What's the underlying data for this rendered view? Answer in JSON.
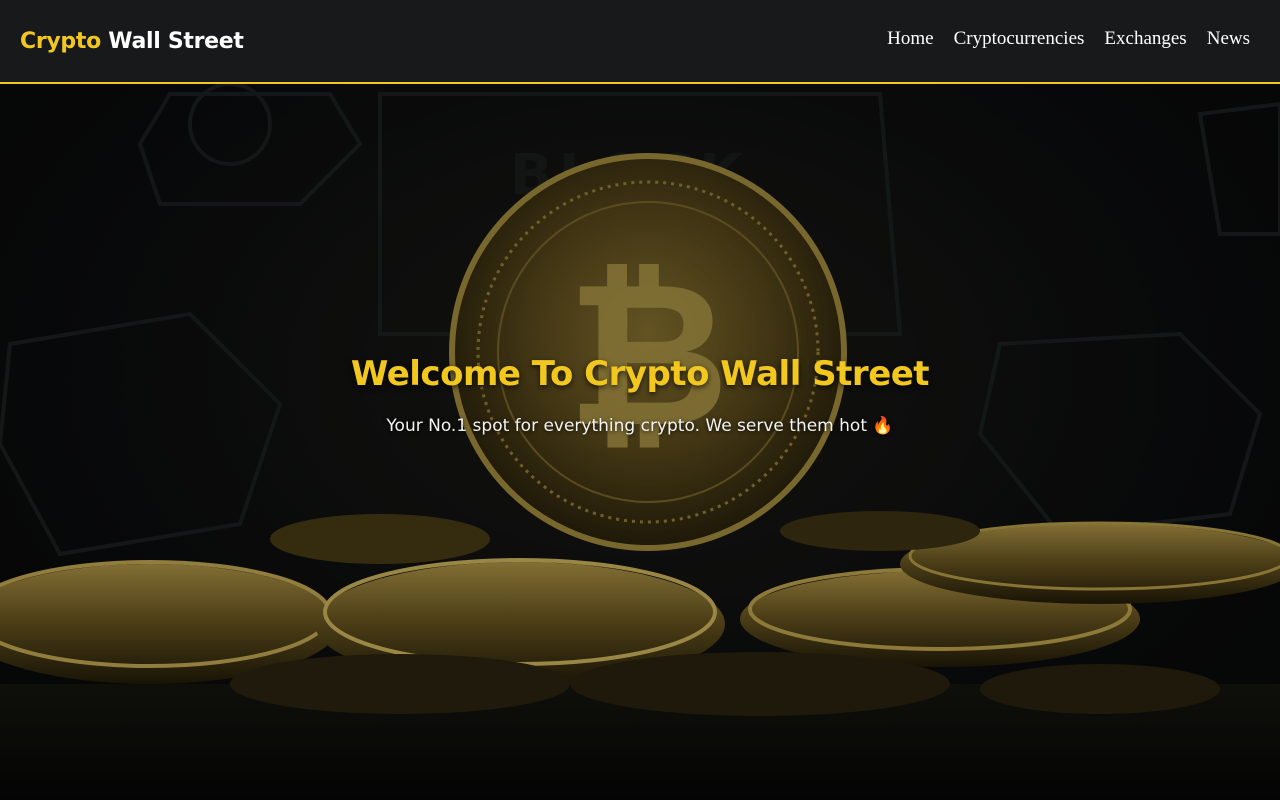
{
  "brand": {
    "accent": "Crypto",
    "rest": "Wall Street"
  },
  "nav": {
    "items": [
      "Home",
      "Cryptocurrencies",
      "Exchanges",
      "News"
    ]
  },
  "hero": {
    "title": "Welcome To Crypto Wall Street",
    "subtitle": "Your No.1 spot for everything crypto. We serve them hot 🔥",
    "background_image_text": "BLOCK CHAIN"
  },
  "colors": {
    "accent": "#f2c81e",
    "navbar": "#18191a",
    "text": "#ffffff"
  }
}
